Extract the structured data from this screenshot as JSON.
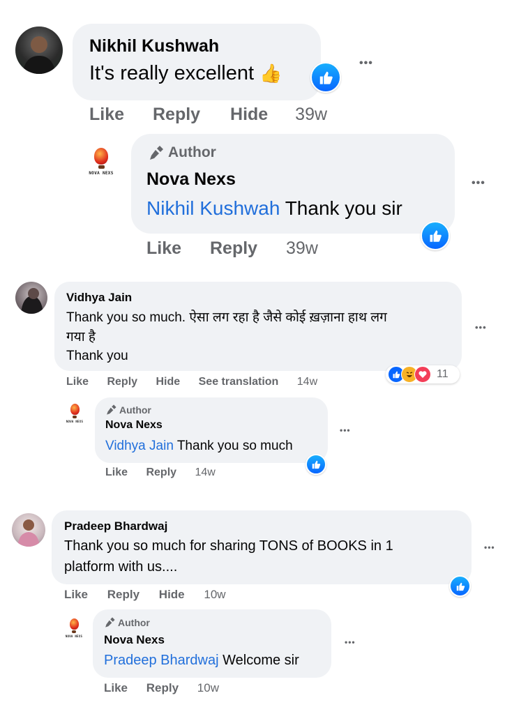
{
  "c1": {
    "name": "Nikhil Kushwah",
    "text": "It's really excellent",
    "emoji": "👍",
    "actions": {
      "like": "Like",
      "reply": "Reply",
      "hide": "Hide",
      "time": "39w"
    },
    "more": "•••",
    "reply": {
      "author_badge": "Author",
      "name": "Nova Nexs",
      "mention": "Nikhil Kushwah",
      "text": " Thank you sir",
      "logo_text": "NOVA NEXS",
      "actions": {
        "like": "Like",
        "reply": "Reply",
        "time": "39w"
      },
      "more": "•••"
    }
  },
  "c2": {
    "name": "Vidhya Jain",
    "text_line1": "Thank you so much. ऐसा लग रहा है जैसे कोई ख़ज़ाना हाथ लग",
    "text_line2": "गया है",
    "text_line3": "Thank you",
    "reaction_count": "11",
    "actions": {
      "like": "Like",
      "reply": "Reply",
      "hide": "Hide",
      "translate": "See translation",
      "time": "14w"
    },
    "more": "•••",
    "reply": {
      "author_badge": "Author",
      "name": "Nova Nexs",
      "mention": "Vidhya Jain",
      "text": " Thank you so much",
      "logo_text": "NOVA NEXS",
      "actions": {
        "like": "Like",
        "reply": "Reply",
        "time": "14w"
      },
      "more": "•••"
    }
  },
  "c3": {
    "name": "Pradeep Bhardwaj",
    "text_line1": "Thank you so much for sharing TONS of BOOKS in 1",
    "text_line2": "platform with us....",
    "actions": {
      "like": "Like",
      "reply": "Reply",
      "hide": "Hide",
      "time": "10w"
    },
    "more": "•••",
    "reply": {
      "author_badge": "Author",
      "name": "Nova Nexs",
      "mention": "Pradeep Bhardwaj",
      "text": " Welcome sir",
      "logo_text": "NOVA NEXS",
      "actions": {
        "like": "Like",
        "reply": "Reply",
        "time": "10w"
      },
      "more": "•••"
    }
  },
  "colors": {
    "bubble": "#f0f2f5",
    "meta": "#65676b",
    "mention": "#216fdb",
    "like": "#0866ff"
  }
}
